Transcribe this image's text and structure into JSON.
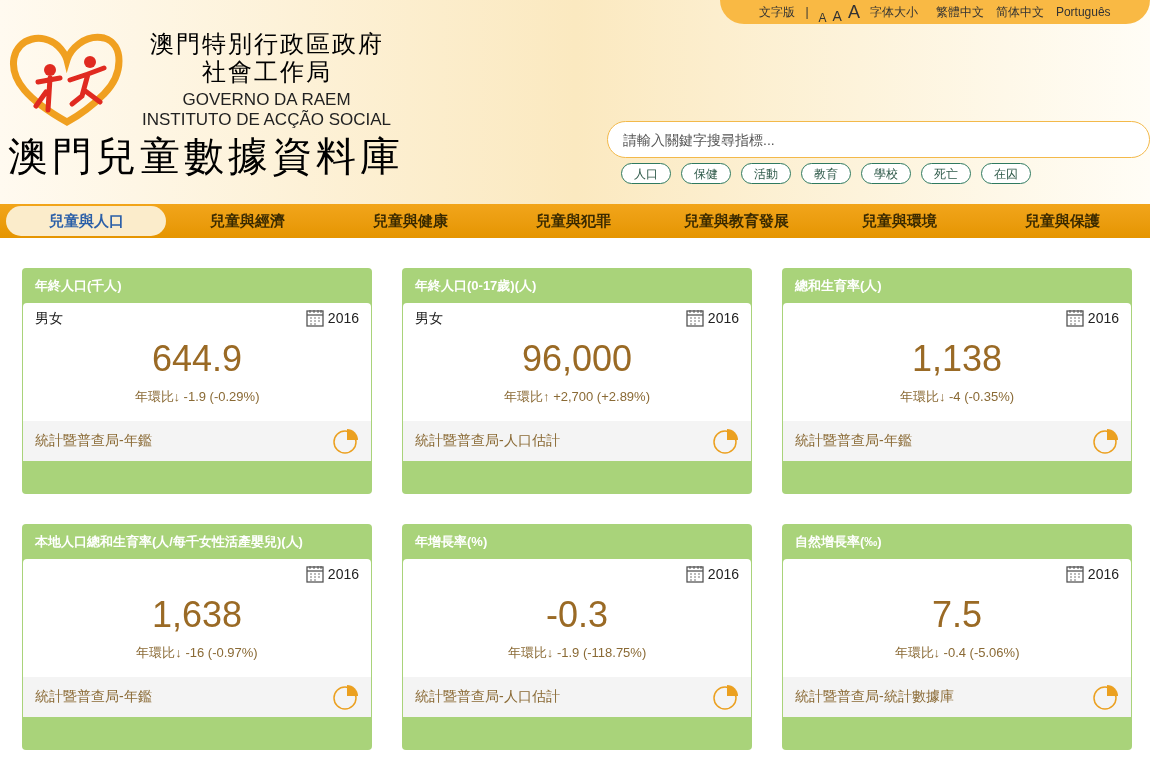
{
  "header": {
    "org_zh_1": "澳門特別行政區政府",
    "org_zh_2": "社會工作局",
    "org_pt_1": "GOVERNO DA RAEM",
    "org_pt_2": "INSTITUTO DE ACÇÃO SOCIAL",
    "site_title": "澳門兒童數據資料庫"
  },
  "top_links": {
    "text_version": "文字版",
    "separator": "|",
    "font_sizes": [
      "A",
      "A",
      "A"
    ],
    "font_size_label": "字体大小",
    "languages": [
      "繁體中文",
      "简体中文",
      "Português"
    ]
  },
  "search": {
    "placeholder": "請輸入關鍵字搜尋指標..."
  },
  "tags": [
    "人口",
    "保健",
    "活動",
    "教育",
    "學校",
    "死亡",
    "在囚"
  ],
  "nav": [
    {
      "label": "兒童與人口",
      "selected": true
    },
    {
      "label": "兒童與經濟",
      "selected": false
    },
    {
      "label": "兒童與健康",
      "selected": false
    },
    {
      "label": "兒童與犯罪",
      "selected": false
    },
    {
      "label": "兒童與教育發展",
      "selected": false
    },
    {
      "label": "兒童與環境",
      "selected": false
    },
    {
      "label": "兒童與保護",
      "selected": false
    }
  ],
  "cards": [
    {
      "title": "年終人口(千人)",
      "subtitle": "男女",
      "year": "2016",
      "value": "644.9",
      "change": "年環比↓ -1.9 (-0.29%)",
      "source": "統計暨普查局-年鑑"
    },
    {
      "title": "年終人口(0-17歲)(人)",
      "subtitle": "男女",
      "year": "2016",
      "value": "96,000",
      "change": "年環比↑ +2,700 (+2.89%)",
      "source": "統計暨普查局-人口估計"
    },
    {
      "title": "總和生育率(人)",
      "year": "2016",
      "value": "1,138",
      "change": "年環比↓ -4 (-0.35%)",
      "source": "統計暨普查局-年鑑"
    },
    {
      "title": "本地人口總和生育率(人/每千女性活產嬰兒)(人)",
      "year": "2016",
      "value": "1,638",
      "change": "年環比↓ -16 (-0.97%)",
      "source": "統計暨普查局-年鑑"
    },
    {
      "title": "年增長率(%)",
      "year": "2016",
      "value": "-0.3",
      "change": "年環比↓ -1.9 (-118.75%)",
      "source": "統計暨普查局-人口估計"
    },
    {
      "title": "自然增長率(‰)",
      "year": "2016",
      "value": "7.5",
      "change": "年環比↓ -0.4 (-5.06%)",
      "source": "統計暨普查局-統計數據庫"
    }
  ]
}
